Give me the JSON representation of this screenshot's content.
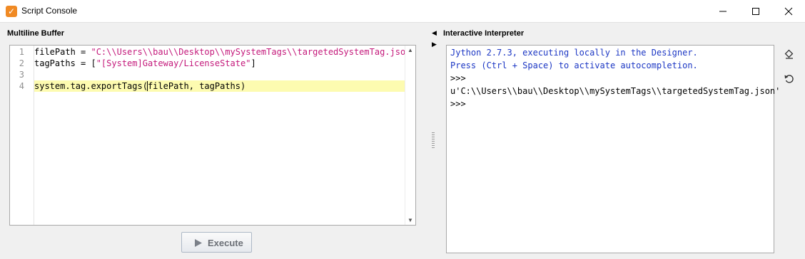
{
  "window": {
    "title": "Script Console",
    "icon": "ignition-designer-icon",
    "controls": [
      "minimize-icon",
      "maximize-icon",
      "close-icon"
    ]
  },
  "buffer": {
    "label": "Multiline Buffer",
    "line_numbers": [
      "1",
      "2",
      "3",
      "4"
    ],
    "lines": [
      {
        "name": "filePath",
        "op": " = ",
        "str": "\"C:\\\\Users\\\\bau\\\\Desktop\\\\mySystemTags\\\\targetedSystemTag.json\""
      },
      {
        "name": "tagPaths",
        "op": " = [",
        "str": "\"[System]Gateway/LicenseState\"",
        "end": "]"
      },
      {
        "text": ""
      },
      {
        "before_caret": "system.tag.exportTags(",
        "after_caret": "filePath, tagPaths)"
      }
    ],
    "execute_label": "Execute"
  },
  "interpreter": {
    "label": "Interactive Interpreter",
    "output": [
      {
        "kind": "info",
        "text": "Jython 2.7.3, executing locally in the Designer."
      },
      {
        "kind": "info",
        "text": "Press (Ctrl + Space) to activate autocompletion."
      },
      {
        "kind": "prompt",
        "text": ">>>"
      },
      {
        "kind": "prompt",
        "text": "u'C:\\\\Users\\\\bau\\\\Desktop\\\\mySystemTags\\\\targetedSystemTag.json'"
      },
      {
        "kind": "prompt",
        "text": ">>>"
      }
    ],
    "tools": [
      "eraser-icon",
      "reset-icon"
    ]
  },
  "colors": {
    "string": "#c4197b",
    "info_text": "#1c37c4",
    "current_line": "#fdfbb0",
    "app_icon": "#f08a24"
  }
}
